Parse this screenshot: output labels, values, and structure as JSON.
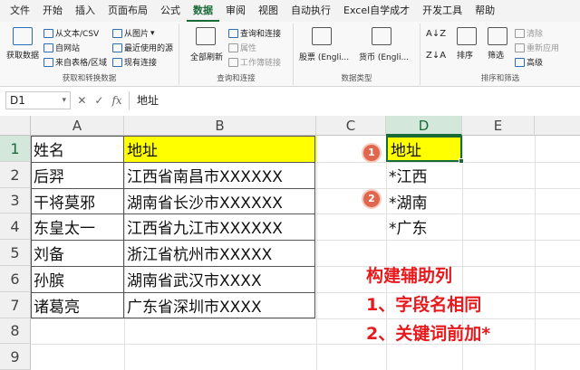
{
  "menu": [
    "文件",
    "开始",
    "插入",
    "页面布局",
    "公式",
    "数据",
    "审阅",
    "视图",
    "自动执行",
    "Excel自学成才",
    "开发工具",
    "帮助"
  ],
  "active_menu": "数据",
  "ribbon": {
    "get_transform": {
      "get_data": "获取数据",
      "from_text_csv": "从文本/CSV",
      "from_web": "自网站",
      "from_table": "来自表格/区域",
      "from_picture": "从图片",
      "recent_sources": "最近使用的源",
      "existing_connections": "现有连接",
      "label": "获取和转换数据"
    },
    "queries": {
      "refresh_all": "全部刷新",
      "queries_connections": "查询和连接",
      "properties": "属性",
      "workbook_links": "工作簿链接",
      "label": "查询和连接"
    },
    "data_types": {
      "stocks": "股票 (Engli...",
      "currency": "货币 (Engli...",
      "label": "数据类型"
    },
    "sort_filter": {
      "sort": "排序",
      "filter": "筛选",
      "clear": "清除",
      "reapply": "重新应用",
      "advanced": "高级",
      "label": "排序和筛选"
    }
  },
  "formula_bar": {
    "name_box": "D1",
    "fx": "fx",
    "value": "地址"
  },
  "columns": [
    "A",
    "B",
    "C",
    "D",
    "E"
  ],
  "rows": [
    "1",
    "2",
    "3",
    "4",
    "5",
    "6",
    "7",
    "8",
    "9"
  ],
  "table": {
    "headers": [
      "姓名",
      "地址"
    ],
    "rows": [
      [
        "后羿",
        "江西省南昌市XXXXXX"
      ],
      [
        "干将莫邪",
        "湖南省长沙市XXXXXX"
      ],
      [
        "东皇太一",
        "江西省九江市XXXXXX"
      ],
      [
        "刘备",
        "浙江省杭州市XXXXX"
      ],
      [
        "孙膑",
        "湖南省武汉市XXXX"
      ],
      [
        "诸葛亮",
        "广东省深圳市XXXX"
      ]
    ]
  },
  "criteria": {
    "header": "地址",
    "values": [
      "*江西",
      "*湖南",
      "*广东"
    ]
  },
  "badges": [
    "1",
    "2"
  ],
  "note": {
    "line1": "构建辅助列",
    "line2": "1、字段名相同",
    "line3": "2、关键词前加*"
  },
  "colors": {
    "accent": "#1a6a38",
    "highlight": "#ffff00",
    "note": "#e8191c",
    "badge": "#e0674d"
  }
}
